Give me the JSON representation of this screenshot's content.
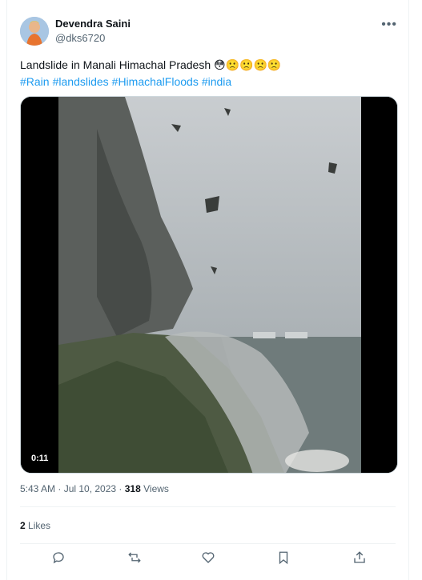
{
  "author": {
    "name": "Devendra Saini",
    "handle": "@dks6720"
  },
  "tweet": {
    "text": "Landslide in Manali Himachal Pradesh",
    "emojis": "😳🙁🙁🙁🙁",
    "hashtags": [
      "#Rain",
      "#landslides",
      "#HimachalFloods",
      "#india"
    ]
  },
  "video": {
    "duration": "0:11"
  },
  "meta": {
    "timestamp": "5:43 AM · Jul 10, 2023",
    "views_count": "318",
    "views_label": "Views"
  },
  "engagement": {
    "likes_count": "2",
    "likes_label": "Likes"
  },
  "actions": [
    "reply-icon",
    "retweet-icon",
    "like-icon",
    "bookmark-icon",
    "share-icon"
  ],
  "colors": {
    "link": "#1d9bf0",
    "secondary_text": "#536471",
    "divider": "#eff3f4"
  }
}
